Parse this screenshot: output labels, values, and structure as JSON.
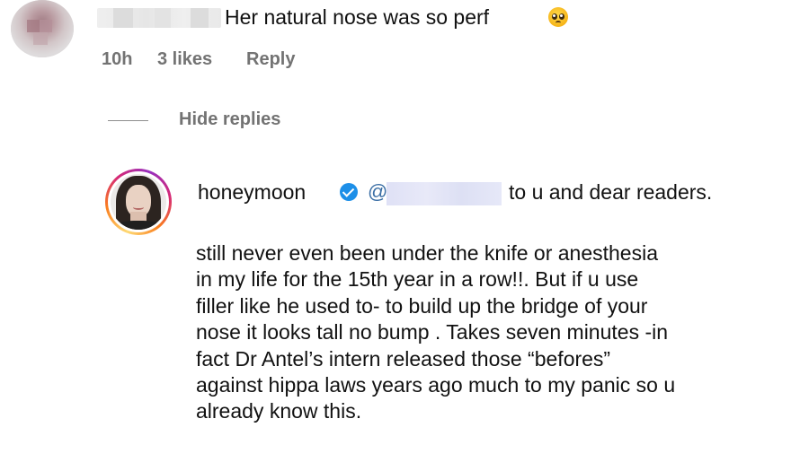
{
  "top_comment": {
    "text": "Her natural nose was so perf",
    "meta": {
      "time": "10h",
      "likes": "3 likes",
      "reply_label": "Reply"
    }
  },
  "replies_toggle": {
    "label": "Hide replies"
  },
  "reply": {
    "username": "honeymoon",
    "mention_prefix": "@",
    "first_line_tail": "to u and dear readers.",
    "body_lines": [
      "still never even been under the knife or anesthesia",
      "in my life for the 15th year in a row!!. But if u use",
      "filler like he used to- to build up the bridge of your",
      "nose it looks tall no bump . Takes seven minutes -in",
      "fact Dr Antel’s intern released those “befores”",
      "against hippa laws years ago much to my panic so u",
      "already know this."
    ]
  },
  "icons": {
    "verified": "verified-badge-icon",
    "emoji": "pleading-face-icon"
  },
  "colors": {
    "meta_gray": "#737373",
    "verified_blue": "#1d8fe8",
    "mention_blue": "#3a6ea5",
    "redaction_lavender": "#e0e2f6"
  }
}
